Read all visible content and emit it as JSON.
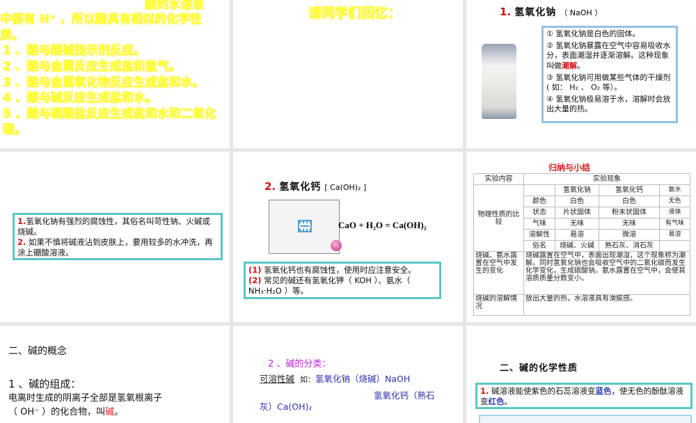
{
  "slides": {
    "s1": {
      "partial_title": "酸的水溶液",
      "line1": "中都有 H⁺ ，所以酸具有相似的化学性",
      "line2": "质。",
      "items": [
        "1 、酸与酸碱指示剂反应。",
        "2 、酸与金属反应生成盐和氢气。",
        "3 、酸与金属氧化物反应生成盐和水。",
        "4 、酸与碱反应生成盐和水。",
        "5 、酸与碳酸盐反应生成盐和水和二氧化",
        "碳。"
      ]
    },
    "s2": {
      "title": "请同学们回忆："
    },
    "s3": {
      "num": "1.",
      "title": "氢氧化钠",
      "formula": "（ NaOH ）",
      "p1": "① 氢氧化钠是白色的固体。",
      "p2a": "② 氢氧化钠暴露在空气中容易吸收水分，表面潮湿并逐渐溶解。这种现象叫做",
      "p2b": "潮解",
      "p2c": "。",
      "p3": "③ 氢氧化钠可用做某些气体的干燥剂 ( 如： H₂ 、 O₂ 等）。",
      "p4": "④ 氢氧化钠极易溶于水，溶解时会放出大量的热。"
    },
    "s4": {
      "n1": "1.",
      "t1": "氢氧化钠有强烈的腐蚀性，其俗名叫苛性钠、火碱或烧碱。",
      "n2": "2.",
      "t2": "如果不慎将碱液沾到皮肤上，要用较多的水冲洗，再涂上硼酸溶液。"
    },
    "s5": {
      "num": "2.",
      "title": "氢氧化钙",
      "formula": "[ Ca(OH)₂ ]",
      "equation": "CaO + H₂O = Ca(OH)₂",
      "n1": "(1)",
      "t1": "氢氧化钙也有腐蚀性，使用时应注意安全。",
      "n2": "(2)",
      "t2": "常见的碱还有氢氧化钾（ KOH ）、氨水（ NH₃·H₂O ）等。"
    },
    "s6": {
      "title": "归纳与小结",
      "h1": "实验内容",
      "h2": "实验现象",
      "phys": "物理性质的比较",
      "cols": [
        "",
        "氢氧化钠",
        "氢氧化钙",
        "氨水"
      ],
      "rows": [
        [
          "颜色",
          "白色",
          "白色",
          "无色"
        ],
        [
          "状态",
          "片状固体",
          "粉末状固体",
          "液体"
        ],
        [
          "气味",
          "无味",
          "无味",
          "有气味"
        ],
        [
          "溶解性",
          "易溶",
          "微溶",
          "易溶"
        ],
        [
          "俗名",
          "烧碱、火碱",
          "熟石灰、消石灰",
          ""
        ]
      ],
      "change_label": "烧碱、氨水露置在空气中发生的变化",
      "change_text": "烧碱露置在空气中，表面出现潮湿，这个现象称为潮解。同时氢氧化钠也会吸收空气中的二氧化碳而发生化学变化，生成碳酸钠。氨水露置在空气中，会使其溶质质量分数变小。",
      "dissolve_label": "烧碱的溶解情况",
      "dissolve_text": "放出大量的热，水溶液具有滑腻感。"
    },
    "s7": {
      "title": "二、碱的概念",
      "sub": "1 、碱的组成：",
      "l1": "电离时生成的阴离子全部是氢氧根离子",
      "l2": "（ OH⁻ ）的化合物，叫",
      "l2b": "碱",
      "l2c": "。"
    },
    "s8": {
      "title": "2 、碱的分类：",
      "label": "可溶性碱",
      "ex": "如：",
      "naoh": "氢氧化钠（烧碱）NaOH",
      "caoh1": "氢氧化钙（熟石",
      "caoh2": "灰）Ca(OH)₂"
    },
    "s9": {
      "title": "二、碱的化学性质",
      "n1": "1.",
      "t1a": "碱溶液能使紫色的石蕊溶液变",
      "t1b": "蓝色",
      "t1c": "，使无色的酚酞溶液变",
      "t1d": "红色",
      "t1e": "。"
    }
  }
}
